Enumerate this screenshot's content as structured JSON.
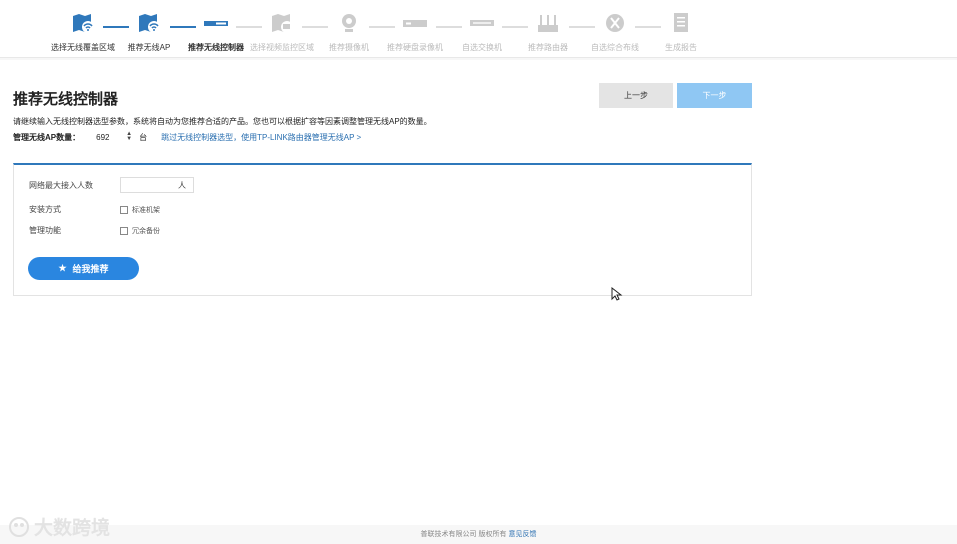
{
  "steps": [
    {
      "label": "选择无线覆盖区域",
      "state": "done",
      "icon": "map-wifi-icon"
    },
    {
      "label": "推荐无线AP",
      "state": "done",
      "icon": "map-ap-icon"
    },
    {
      "label": "推荐无线控制器",
      "state": "active",
      "icon": "controller-icon"
    },
    {
      "label": "选择视频监控区域",
      "state": "pending",
      "icon": "map-camera-icon"
    },
    {
      "label": "推荐摄像机",
      "state": "pending",
      "icon": "camera-icon"
    },
    {
      "label": "推荐硬盘录像机",
      "state": "pending",
      "icon": "nvr-icon"
    },
    {
      "label": "自选交换机",
      "state": "pending",
      "icon": "switch-icon"
    },
    {
      "label": "推荐路由器",
      "state": "pending",
      "icon": "router-icon"
    },
    {
      "label": "自选综合布线",
      "state": "pending",
      "icon": "cabling-icon"
    },
    {
      "label": "生成报告",
      "state": "pending",
      "icon": "report-icon"
    }
  ],
  "page": {
    "title": "推荐无线控制器",
    "prev_label": "上一步",
    "next_label": "下一步",
    "description": "请继续输入无线控制器选型参数，系统将自动为您推荐合适的产品。您也可以根据扩容等因素调整管理无线AP的数量。",
    "ap_count_label": "管理无线AP数量：",
    "ap_count_value": "692",
    "ap_count_unit": "台",
    "skip_link": "跳过无线控制器选型，使用TP-LINK路由器管理无线AP >"
  },
  "form": {
    "max_users_label": "网络最大接入人数",
    "max_users_value": "",
    "max_users_unit": "人",
    "install_label": "安装方式",
    "install_option": "标准机架",
    "manage_label": "管理功能",
    "manage_option": "冗余备份",
    "recommend_label": "给我推荐"
  },
  "footer": {
    "copyright": "普联技术有限公司 版权所有",
    "feedback": "意见反馈"
  },
  "watermark": "大数跨境",
  "colors": {
    "accent": "#2f78bb",
    "primary_button": "#2a86e0",
    "disabled_button": "#8fc7f3"
  }
}
